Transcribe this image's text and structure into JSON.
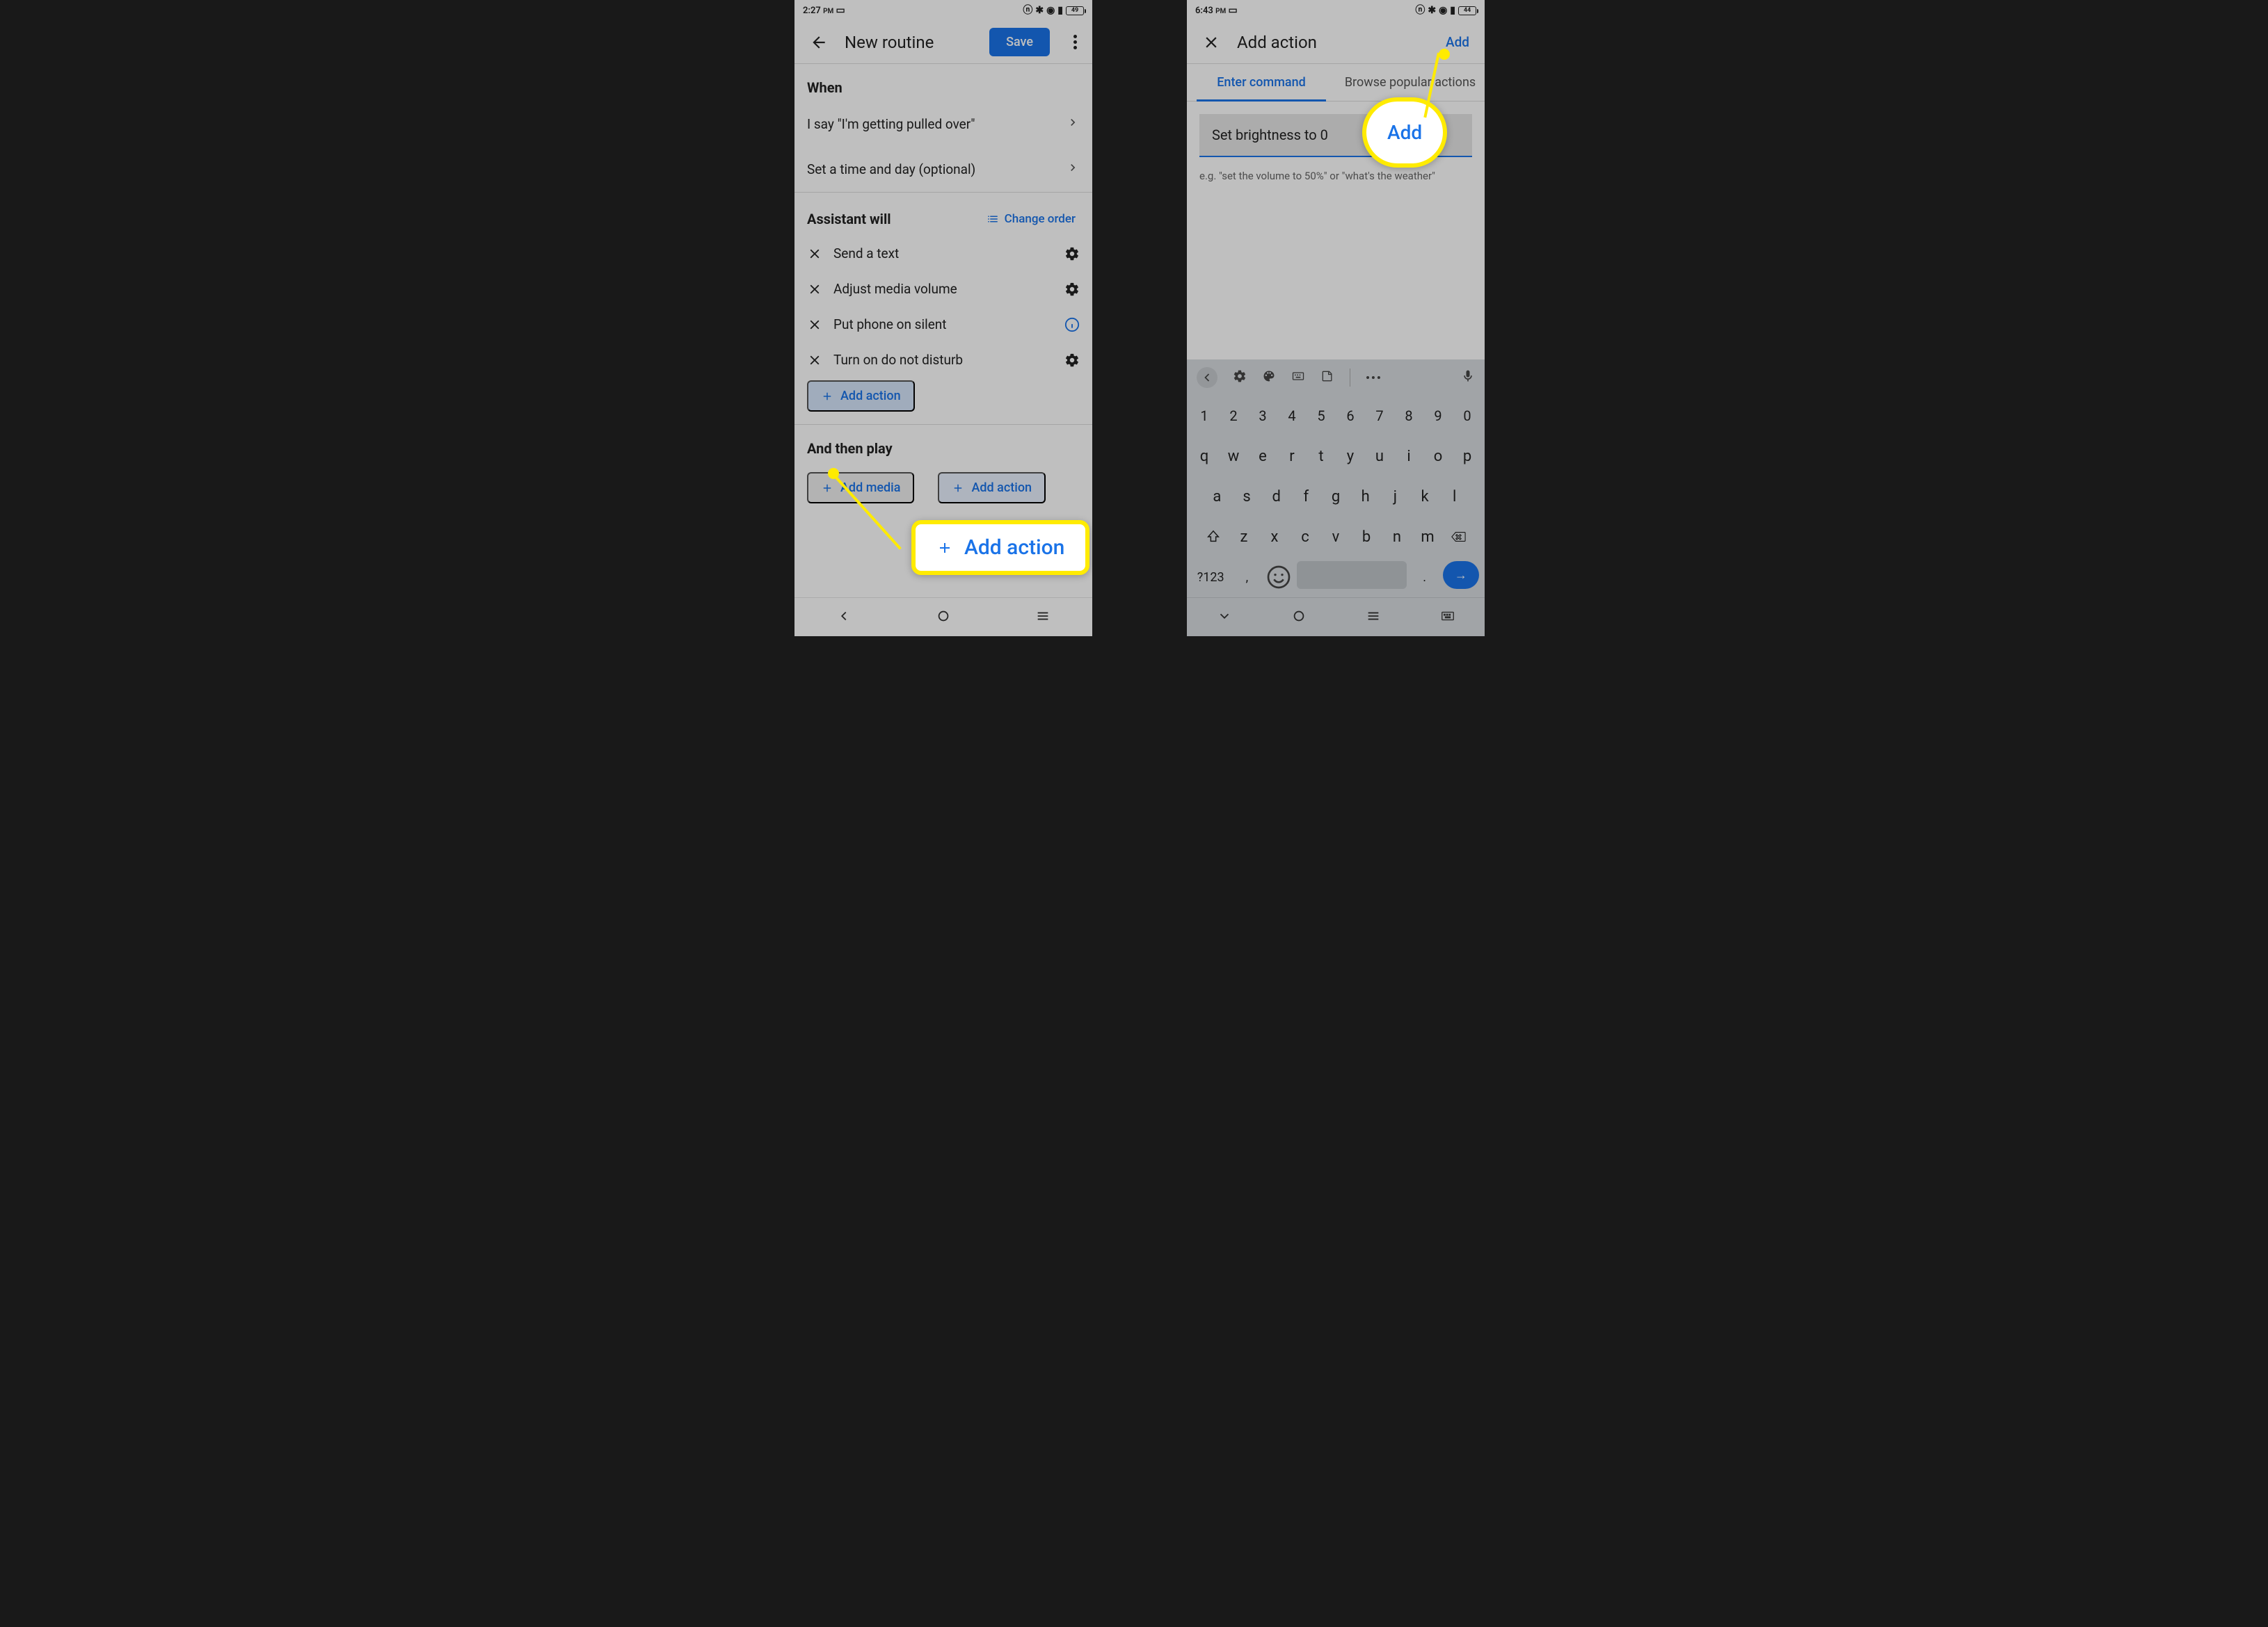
{
  "colors": {
    "brand": "#1a73e8",
    "callout": "#ffeb00"
  },
  "left": {
    "status": {
      "time": "2:27",
      "ampm": "PM",
      "battery": "49"
    },
    "title": "New routine",
    "save": "Save",
    "when": {
      "heading": "When",
      "trigger": "I say \"I'm getting pulled over\"",
      "schedule": "Set a time and day (optional)"
    },
    "assistant": {
      "heading": "Assistant will",
      "change_order": "Change order",
      "actions": [
        {
          "label": "Send a text",
          "icon": "gear"
        },
        {
          "label": "Adjust media volume",
          "icon": "gear"
        },
        {
          "label": "Put phone on silent",
          "icon": "info"
        },
        {
          "label": "Turn on do not disturb",
          "icon": "gear"
        }
      ],
      "add_action": "Add action"
    },
    "then": {
      "heading": "And then play",
      "add_media": "Add media",
      "add_action": "Add action"
    },
    "callout_add_action": "Add action"
  },
  "right": {
    "status": {
      "time": "6:43",
      "ampm": "PM",
      "battery": "44"
    },
    "title": "Add action",
    "add": "Add",
    "tabs": {
      "enter": "Enter command",
      "browse": "Browse popular actions"
    },
    "command_value": "Set brightness to 0",
    "hint": "e.g. \"set the volume to 50%\" or \"what's the weather\"",
    "callout_add": "Add",
    "keyboard": {
      "digits": [
        "1",
        "2",
        "3",
        "4",
        "5",
        "6",
        "7",
        "8",
        "9",
        "0"
      ],
      "row1": [
        "q",
        "w",
        "e",
        "r",
        "t",
        "y",
        "u",
        "i",
        "o",
        "p"
      ],
      "row2": [
        "a",
        "s",
        "d",
        "f",
        "g",
        "h",
        "j",
        "k",
        "l"
      ],
      "row3": [
        "z",
        "x",
        "c",
        "v",
        "b",
        "n",
        "m"
      ],
      "numkey": "?123",
      "comma": ",",
      "period": "."
    }
  }
}
